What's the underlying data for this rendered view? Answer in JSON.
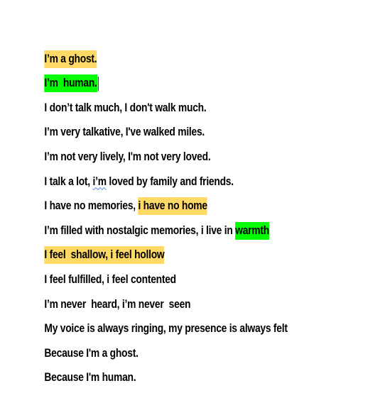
{
  "colors": {
    "highlight_yellow": "#ffd966",
    "highlight_green": "#00ff00",
    "text": "#000000",
    "spellcheck_underline": "#4a7bd6"
  },
  "poem": {
    "lines": [
      {
        "segments": [
          {
            "text": "I’m a ghost.",
            "highlight": "yellow"
          }
        ]
      },
      {
        "segments": [
          {
            "text": "I’m  human.",
            "highlight": "green"
          }
        ],
        "caret": true
      },
      {
        "segments": [
          {
            "text": "I don’t talk much, I don't walk much."
          }
        ]
      },
      {
        "segments": [
          {
            "text": "I’m very talkative, I've walked miles."
          }
        ]
      },
      {
        "segments": [
          {
            "text": "I’m not very lively, I'm not very loved."
          }
        ]
      },
      {
        "segments": [
          {
            "text": "I talk a lot, "
          },
          {
            "text": "i’m",
            "squiggle": true
          },
          {
            "text": " loved by family and friends."
          }
        ]
      },
      {
        "segments": [
          {
            "text": "I have no memories, "
          },
          {
            "text": "i have no home",
            "highlight": "yellow"
          }
        ]
      },
      {
        "segments": [
          {
            "text": "I’m filled with nostalgic memories, i live in "
          },
          {
            "text": "warmth",
            "highlight": "green"
          }
        ]
      },
      {
        "segments": [
          {
            "text": "I feel  shallow, i feel hollow",
            "highlight": "yellow"
          }
        ]
      },
      {
        "segments": [
          {
            "text": "I feel fulfilled, i feel contented"
          }
        ]
      },
      {
        "segments": [
          {
            "text": "I’m never  heard, i’m never  seen"
          }
        ]
      },
      {
        "segments": [
          {
            "text": "My voice is always ringing, my presence is always felt"
          }
        ]
      },
      {
        "segments": [
          {
            "text": "Because I'm a ghost."
          }
        ]
      },
      {
        "segments": [
          {
            "text": "Because I'm human."
          }
        ]
      }
    ]
  }
}
